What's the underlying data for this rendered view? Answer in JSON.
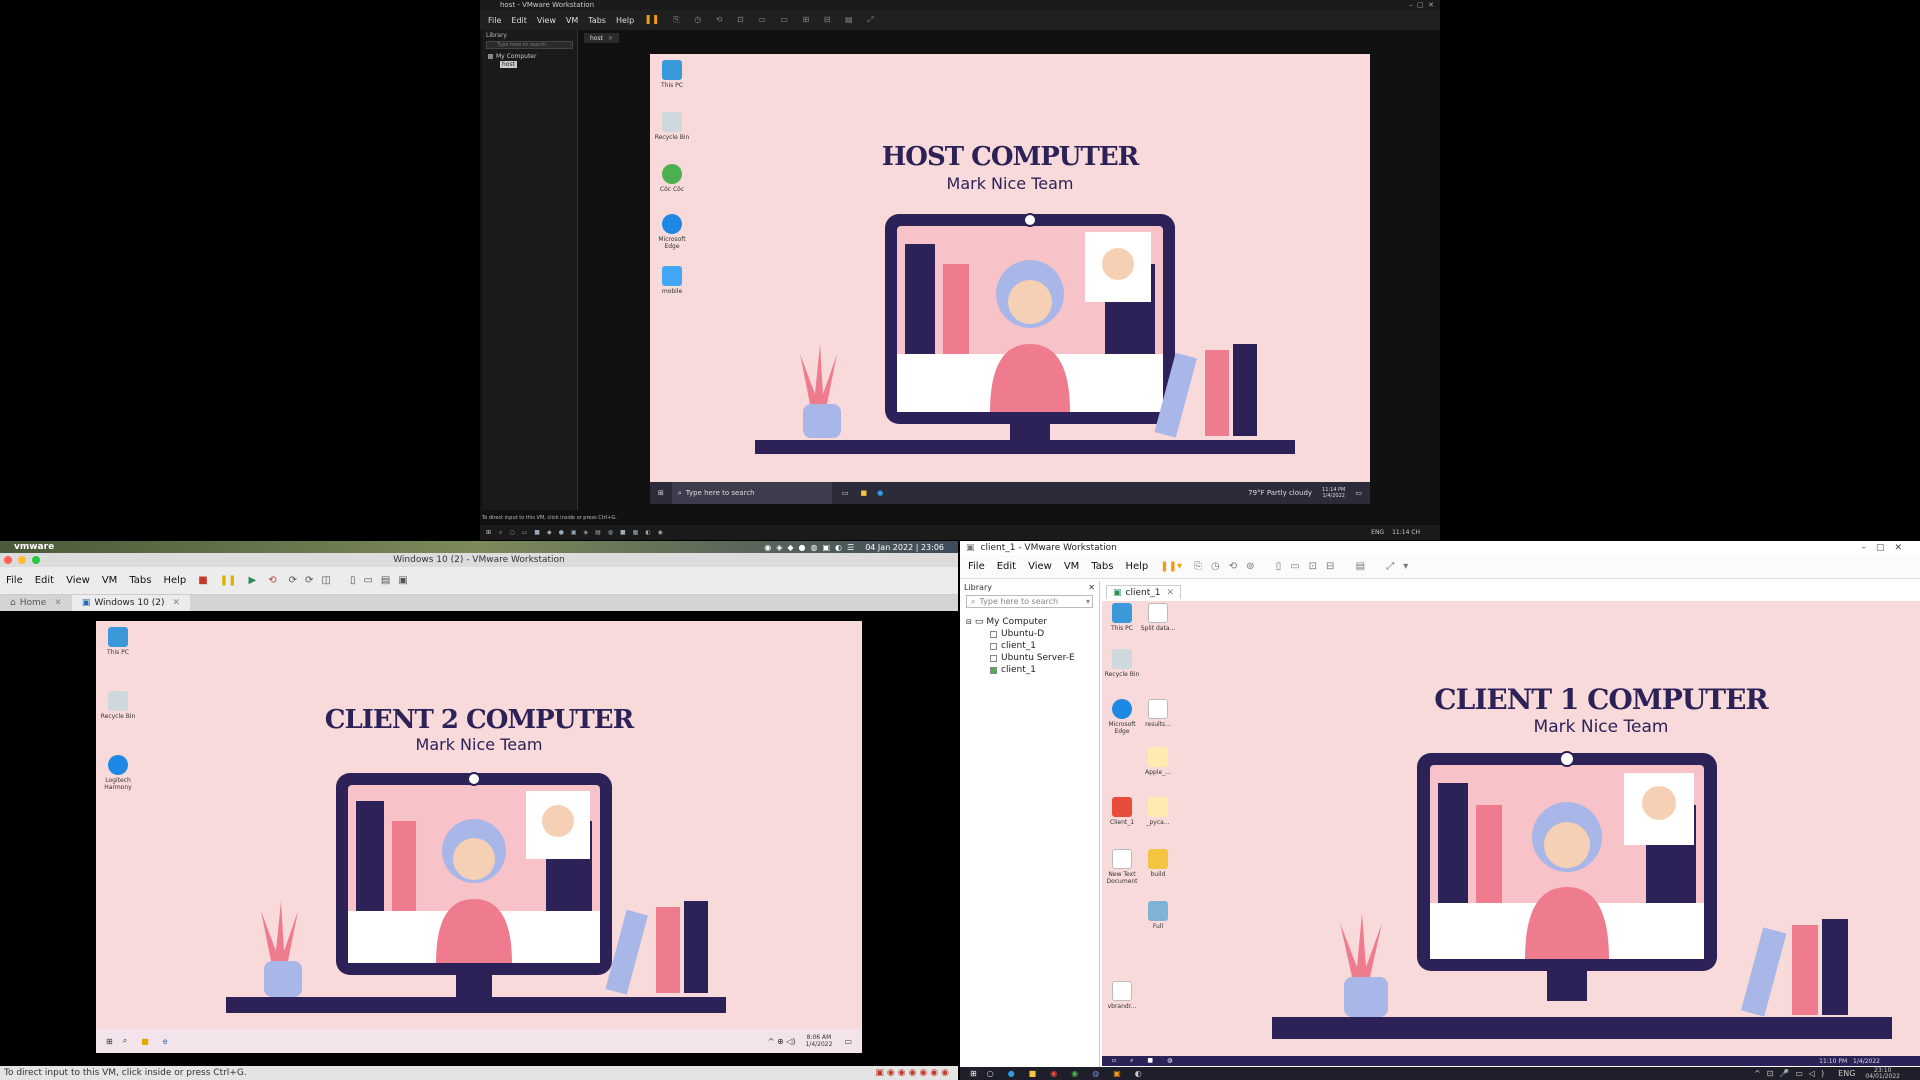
{
  "host_window": {
    "title": "host - VMware Workstation",
    "menu": [
      "File",
      "Edit",
      "View",
      "VM",
      "Tabs",
      "Help"
    ],
    "library_label": "Library",
    "search_placeholder": "Type here to search",
    "tree_root": "My Computer",
    "tree_child": "host",
    "tab_label": "host",
    "status_text": "To direct input to this VM, click inside or press Ctrl+G.",
    "desktop": {
      "icons": [
        "This PC",
        "Recycle Bin",
        "Côc Côc",
        "Microsoft Edge",
        "mobile"
      ],
      "headline": "HOST COMPUTER",
      "subline": "Mark Nice Team",
      "search_text": "Type here to search",
      "weather": "79°F  Partly cloudy",
      "time": "11:14 PM",
      "date": "1/4/2022"
    },
    "host_taskbar": {
      "lang": "ENG",
      "time": "11:14 CH"
    }
  },
  "mac_window": {
    "menu_app": "vmware",
    "window_title": "Windows 10 (2) - VMware Workstation",
    "menu": [
      "File",
      "Edit",
      "View",
      "VM",
      "Tabs",
      "Help"
    ],
    "tabs": [
      "Home",
      "Windows 10 (2)"
    ],
    "clock": "04 Jan 2022 | 23:06",
    "status_text": "To direct input to this VM, click inside or press Ctrl+G.",
    "desktop": {
      "icons": [
        "This PC",
        "Recycle Bin",
        "Logitech Harmony"
      ],
      "headline": "CLIENT 2 COMPUTER",
      "subline": "Mark Nice Team",
      "time": "8:06 AM",
      "date": "1/4/2022"
    }
  },
  "client1_window": {
    "title": "client_1 - VMware Workstation",
    "menu": [
      "File",
      "Edit",
      "View",
      "VM",
      "Tabs",
      "Help"
    ],
    "library_label": "Library",
    "search_placeholder": "Type here to search",
    "tree": [
      "My Computer",
      "Ubuntu-D",
      "client_1",
      "Ubuntu Server-E",
      "client_1"
    ],
    "tab_label": "client_1",
    "desktop": {
      "icons": [
        "This PC",
        "Split data...",
        "Recycle Bin",
        "Microsoft Edge",
        "results...",
        "Apple_...",
        "Client_1",
        "_pyca...",
        "New Text Document",
        "build",
        "Full",
        "vbrandr..."
      ],
      "headline": "CLIENT 1 COMPUTER",
      "subline": "Mark Nice Team",
      "time": "11:10 PM",
      "date": "1/4/2022"
    },
    "taskbar": {
      "lang": "ENG",
      "time": "23:10",
      "date": "04/01/2022"
    }
  },
  "colors": {
    "wallpaper": "#f9dada",
    "ink": "#2c2257",
    "accent_pink": "#ef7c8e"
  }
}
